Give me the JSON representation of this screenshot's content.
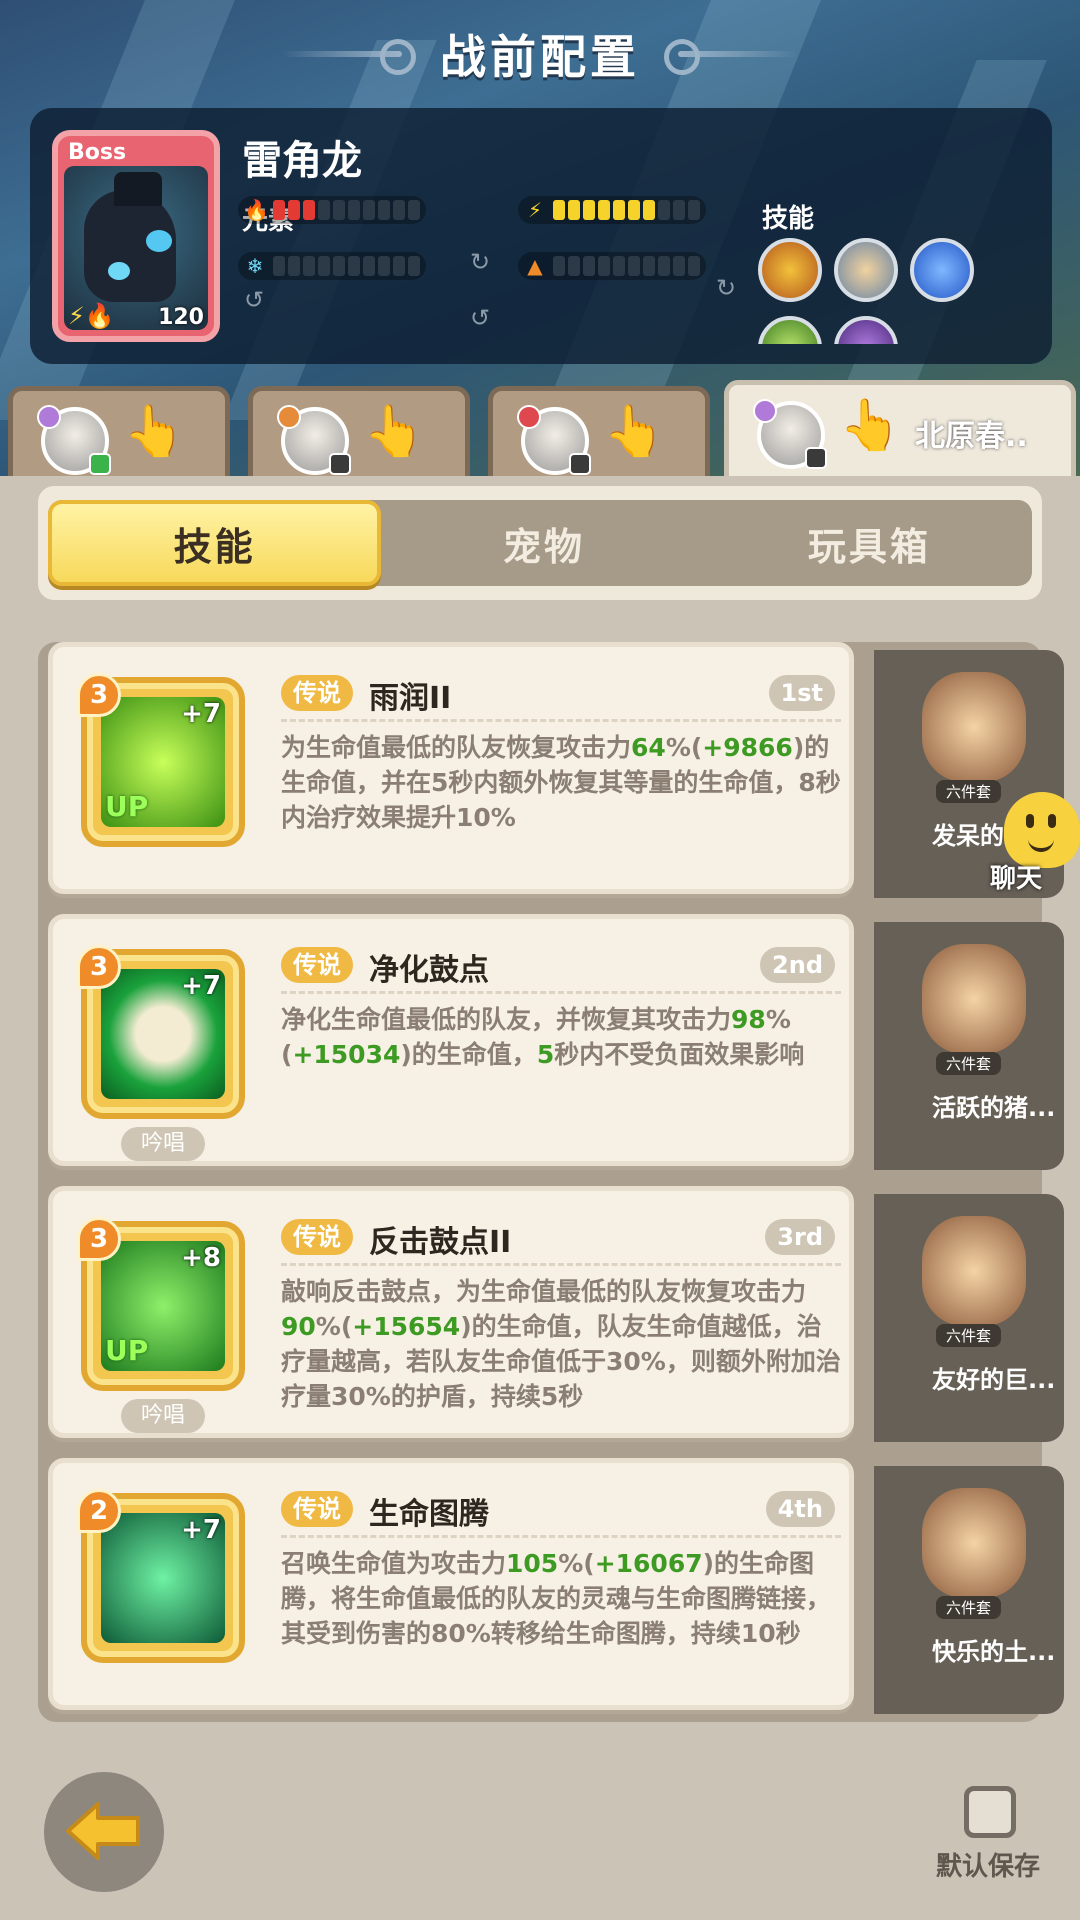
{
  "header": {
    "title": "战前配置"
  },
  "boss": {
    "tag": "Boss",
    "name": "雷角龙",
    "level": "120",
    "element_label": "元素",
    "skill_label": "技能",
    "gauges": [
      {
        "element": "fire",
        "icon": "🔥",
        "filled": 3,
        "total": 10,
        "color": "#e43a34"
      },
      {
        "element": "thunder",
        "icon": "⚡",
        "filled": 7,
        "total": 10,
        "color": "#f5d32a"
      },
      {
        "element": "ice",
        "icon": "❄",
        "filled": 0,
        "total": 10,
        "color": "#6ed8f6"
      },
      {
        "element": "earth",
        "icon": "▲",
        "filled": 0,
        "total": 10,
        "color": "#f08b2a"
      }
    ],
    "skill_icons": [
      "fist-skill-icon",
      "shield-skill-icon",
      "lightning-skill-icon",
      "green-skill-icon",
      "purple-skill-icon"
    ]
  },
  "characters": [
    {
      "name": "",
      "badge_color": "#b07ad8",
      "device": "green"
    },
    {
      "name": "",
      "badge_color": "#e58b3a",
      "device": "dark"
    },
    {
      "name": "",
      "badge_color": "#e0484f",
      "device": "dark"
    },
    {
      "name": "北原春..",
      "badge_color": "#b07ad8",
      "device": "dark"
    }
  ],
  "tabs": {
    "skills": "技能",
    "pets": "宠物",
    "toys": "玩具箱"
  },
  "skills": [
    {
      "level": "3",
      "bonus": "+7",
      "up": "UP",
      "chant": "",
      "rarity": "传说",
      "name": "雨润II",
      "rank": "1st",
      "desc": [
        {
          "t": "为生命值最低的队友恢复攻击力"
        },
        {
          "t": "64",
          "g": true
        },
        {
          "t": "%("
        },
        {
          "t": "+9866",
          "g": true
        },
        {
          "t": ")的生命值，并在5秒内额外恢复其等量的生命值，8秒内治疗效果提升10%"
        }
      ],
      "toy": {
        "set": "六件套",
        "name": "发呆的..."
      }
    },
    {
      "level": "3",
      "bonus": "+7",
      "up": "",
      "chant": "吟唱",
      "rarity": "传说",
      "name": "净化鼓点",
      "rank": "2nd",
      "desc": [
        {
          "t": "净化生命值最低的队友，并恢复其攻击力"
        },
        {
          "t": "98",
          "g": true
        },
        {
          "t": "%("
        },
        {
          "t": "+15034",
          "g": true
        },
        {
          "t": ")的生命值，"
        },
        {
          "t": "5",
          "g": true
        },
        {
          "t": "秒内不受负面效果影响"
        }
      ],
      "toy": {
        "set": "六件套",
        "name": "活跃的猪..."
      }
    },
    {
      "level": "3",
      "bonus": "+8",
      "up": "UP",
      "chant": "吟唱",
      "rarity": "传说",
      "name": "反击鼓点II",
      "rank": "3rd",
      "desc": [
        {
          "t": "敲响反击鼓点，为生命值最低的队友恢复攻击力"
        },
        {
          "t": "90",
          "g": true
        },
        {
          "t": "%("
        },
        {
          "t": "+15654",
          "g": true
        },
        {
          "t": ")的生命值，队友生命值越低，治疗量越高，若队友生命值低于30%，则额外附加治疗量30%的护盾，持续5秒"
        }
      ],
      "toy": {
        "set": "六件套",
        "name": "友好的巨..."
      }
    },
    {
      "level": "2",
      "bonus": "+7",
      "up": "",
      "chant": "",
      "rarity": "传说",
      "name": "生命图腾",
      "rank": "4th",
      "desc": [
        {
          "t": "召唤生命值为攻击力"
        },
        {
          "t": "105",
          "g": true
        },
        {
          "t": "%("
        },
        {
          "t": "+16067",
          "g": true
        },
        {
          "t": ")的生命图腾，将生命值最低的队友的灵魂与生命图腾链接，其受到伤害的80%转移给生命图腾，持续10秒"
        }
      ],
      "toy": {
        "set": "六件套",
        "name": "快乐的土..."
      }
    }
  ],
  "chat": {
    "label": "聊天"
  },
  "footer": {
    "save_label": "默认保存"
  },
  "colors": {
    "accent_yellow": "#f7d95b",
    "legend": "#f0b943",
    "number_green": "#3d9a23"
  }
}
